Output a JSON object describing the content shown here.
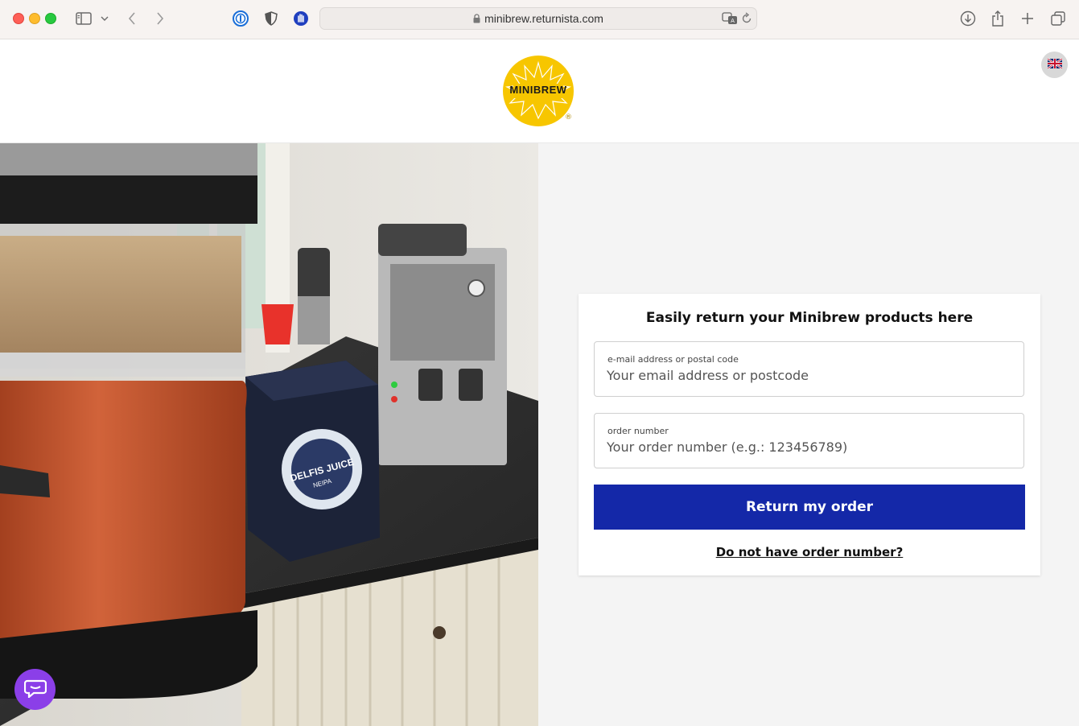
{
  "browser": {
    "url": "minibrew.returnista.com"
  },
  "header": {
    "logo_text": "MINIBREW",
    "logo_mark": "®",
    "language_icon": "uk-flag-icon"
  },
  "photo": {
    "box_label_1": "DELFIS JUICE",
    "box_label_2": "NEIPA"
  },
  "form": {
    "title": "Easily return your Minibrew products here",
    "email_label": "e-mail address or postal code",
    "email_placeholder": "Your email address or postcode",
    "email_value": "",
    "order_label": "order number",
    "order_placeholder": "Your order number (e.g.: 123456789)",
    "order_value": "",
    "submit_label": "Return my order",
    "no_order_link": "Do not have order number?"
  },
  "colors": {
    "accent": "#1428a8",
    "logo_yellow": "#f7c600",
    "chat": "#8b3fe8"
  },
  "icons": [
    "sidebar-icon",
    "chevron-down-icon",
    "back-icon",
    "forward-icon",
    "password-manager-icon",
    "shield-icon",
    "hand-icon",
    "lock-icon",
    "translate-icon",
    "reload-icon",
    "download-icon",
    "share-icon",
    "plus-icon",
    "tabs-icon",
    "chat-icon"
  ]
}
